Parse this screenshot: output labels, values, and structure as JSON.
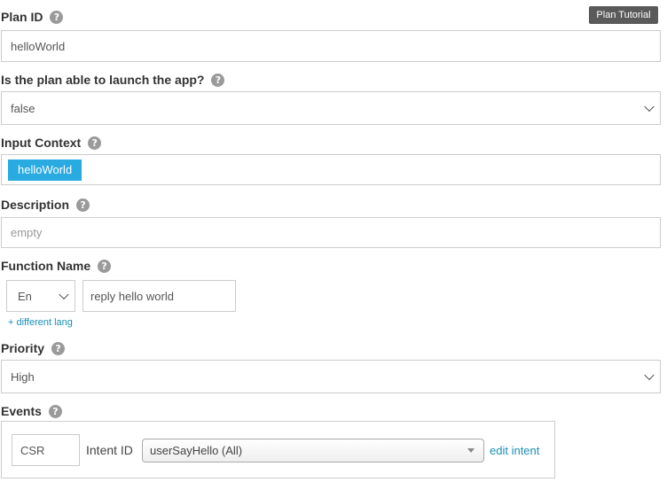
{
  "plan_id": {
    "label": "Plan ID",
    "value": "helloWorld"
  },
  "tutorial_button": "Plan Tutorial",
  "launch": {
    "label": "Is the plan able to launch the app?",
    "selected": "false"
  },
  "input_context": {
    "label": "Input Context",
    "tags": [
      "helloWorld"
    ]
  },
  "description": {
    "label": "Description",
    "placeholder": "empty"
  },
  "function_name": {
    "label": "Function Name",
    "lang_selected": "En",
    "value": "reply hello world",
    "add_lang": "+ different lang"
  },
  "priority": {
    "label": "Priority",
    "selected": "High"
  },
  "events": {
    "label": "Events",
    "csr_value": "CSR",
    "intent_label": "Intent ID",
    "intent_selected": "userSayHello (All)",
    "edit_link": "edit intent"
  },
  "help_glyph": "?",
  "colors": {
    "accent": "#29aae1",
    "link": "#1a8fb5",
    "tutorial_bg": "#5a5a5a"
  }
}
